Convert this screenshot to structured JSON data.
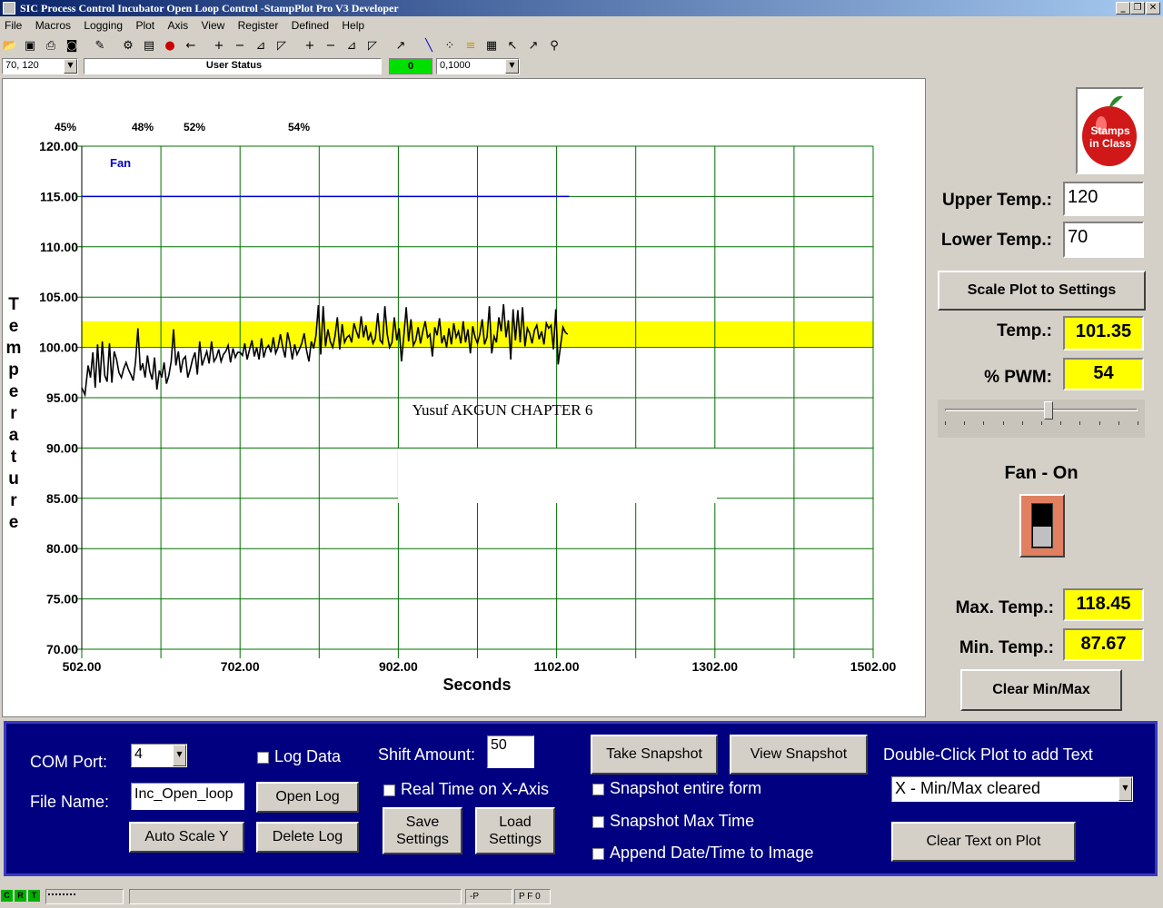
{
  "window": {
    "title": "SIC Process Control Incubator Open Loop Control -StampPlot Pro V3 Developer"
  },
  "menu": [
    "File",
    "Macros",
    "Logging",
    "Plot",
    "Axis",
    "View",
    "Register",
    "Defined",
    "Help"
  ],
  "statusrow": {
    "range_value": "70, 120",
    "user_status": "User Status",
    "counter": "0",
    "scale_value": "0,1000"
  },
  "plot": {
    "percent_labels": [
      "45%",
      "48%",
      "52%",
      "54%"
    ],
    "fan_label": "Fan",
    "annotation": "Yusuf AKGUN CHAPTER 6",
    "ylabel_letters": [
      "T",
      "e",
      "m",
      "p",
      "e",
      "r",
      "a",
      "t",
      "u",
      "r",
      "e"
    ],
    "colors": {
      "grid": "#007000",
      "trace": "#000000",
      "fan_line": "#0000cc",
      "band": "#ffff00"
    }
  },
  "chart_data": {
    "type": "line",
    "xlabel": "Seconds",
    "ylabel": "Temperature",
    "xlim": [
      502,
      1502
    ],
    "ylim": [
      70,
      120
    ],
    "x_ticks": [
      "502.00",
      "702.00",
      "902.00",
      "1102.00",
      "1302.00",
      "1502.00"
    ],
    "y_ticks": [
      "120.00",
      "115.00",
      "110.00",
      "105.00",
      "100.00",
      "95.00",
      "90.00",
      "85.00",
      "80.00",
      "75.00",
      "70.00"
    ],
    "band": {
      "y_from": 100.0,
      "y_to": 102.6
    },
    "fan_line": {
      "y": 115,
      "x_from": 502,
      "x_to": 1118
    },
    "series": [
      {
        "x": [
          502,
          506,
          510,
          513,
          516,
          519,
          522,
          525,
          528,
          531,
          534,
          537,
          540,
          543,
          546,
          549,
          552,
          555,
          558,
          561,
          564,
          567,
          570,
          573,
          576,
          579,
          582,
          585,
          588,
          591,
          594,
          597,
          600,
          603,
          606,
          609,
          612,
          615,
          618,
          621,
          624,
          627,
          630,
          633,
          636,
          639,
          642,
          645,
          648,
          651,
          654,
          657,
          660,
          663,
          666,
          669,
          672,
          675,
          678,
          681,
          684,
          687,
          690,
          693,
          696,
          699,
          702,
          705,
          708,
          711,
          714,
          717,
          720,
          723,
          726,
          729,
          732,
          735,
          738,
          741,
          744,
          747,
          750,
          753,
          756,
          759,
          762,
          765,
          768,
          771,
          774,
          777,
          780,
          783,
          786,
          789,
          792,
          795,
          798,
          801,
          804,
          807,
          810,
          813,
          816,
          819,
          822,
          825,
          828,
          831,
          834,
          837,
          840,
          843,
          846,
          849,
          852,
          855,
          858,
          861,
          864,
          867,
          870,
          873,
          876,
          879,
          882,
          885,
          888,
          891,
          894,
          897,
          900,
          903,
          906,
          909,
          912,
          915,
          918,
          921,
          924,
          927,
          930,
          933,
          936,
          939,
          942,
          945,
          948,
          951,
          954,
          957,
          960,
          963,
          966,
          969,
          972,
          975,
          978,
          981,
          984,
          987,
          990,
          993,
          996,
          999,
          1002,
          1005,
          1008,
          1011,
          1014,
          1017,
          1020,
          1023,
          1026,
          1029,
          1032,
          1035,
          1038,
          1041,
          1044,
          1047,
          1050,
          1053,
          1056,
          1059,
          1062,
          1065,
          1068,
          1071,
          1074,
          1077,
          1080,
          1083,
          1086,
          1089,
          1092,
          1095,
          1098,
          1101,
          1104,
          1107,
          1110,
          1113,
          1116
        ],
        "y": [
          96.0,
          95.3,
          98.2,
          97.0,
          99.5,
          96.0,
          100.3,
          96.5,
          100.6,
          97.2,
          96.6,
          100.4,
          96.5,
          99.6,
          98.8,
          97.5,
          97.0,
          97.9,
          98.5,
          97.8,
          97.3,
          96.7,
          98.6,
          101.9,
          97.7,
          98.4,
          97.0,
          99.2,
          97.6,
          96.8,
          99.0,
          95.8,
          97.7,
          97.0,
          98.5,
          96.4,
          97.2,
          98.6,
          101.8,
          98.2,
          99.6,
          97.5,
          98.8,
          99.1,
          97.0,
          97.8,
          98.8,
          99.5,
          97.3,
          100.6,
          98.2,
          98.9,
          99.6,
          98.4,
          100.6,
          98.6,
          99.0,
          99.8,
          98.6,
          99.3,
          99.6,
          100.2,
          98.5,
          99.9,
          99.0,
          99.5,
          99.5,
          99.2,
          100.4,
          98.8,
          99.8,
          100.7,
          99.1,
          100.0,
          98.8,
          100.9,
          99.0,
          99.9,
          100.2,
          99.5,
          101.0,
          99.4,
          100.0,
          101.3,
          100.0,
          99.0,
          101.5,
          100.4,
          98.8,
          100.3,
          99.3,
          99.8,
          100.4,
          101.4,
          99.7,
          98.6,
          100.6,
          99.9,
          101.2,
          104.2,
          99.3,
          104.1,
          100.1,
          101.8,
          100.6,
          100.0,
          101.1,
          103.0,
          99.8,
          102.3,
          100.5,
          101.0,
          101.2,
          100.5,
          102.4,
          101.6,
          100.9,
          103.1,
          101.0,
          102.2,
          100.7,
          101.4,
          100.4,
          100.9,
          103.4,
          100.7,
          100.4,
          104.1,
          101.3,
          100.0,
          100.5,
          103.0,
          100.7,
          101.9,
          98.6,
          101.2,
          104.0,
          100.6,
          102.8,
          100.2,
          100.7,
          102.0,
          100.4,
          101.6,
          102.6,
          101.0,
          101.3,
          99.1,
          102.0,
          101.2,
          102.9,
          100.4,
          101.2,
          100.0,
          101.9,
          100.3,
          102.4,
          101.0,
          101.6,
          100.4,
          102.6,
          100.5,
          101.8,
          99.4,
          102.1,
          101.0,
          100.4,
          101.3,
          102.8,
          100.3,
          101.0,
          104.1,
          99.4,
          101.1,
          100.5,
          103.0,
          101.6,
          104.3,
          101.0,
          102.7,
          98.8,
          103.8,
          100.7,
          103.7,
          100.5,
          104.0,
          100.1,
          101.9,
          101.4,
          100.4,
          101.7,
          102.2,
          100.8,
          101.6,
          100.3,
          102.4,
          101.9,
          102.2,
          99.8,
          103.8,
          98.3,
          100.2,
          102.0,
          101.5,
          101.3
        ]
      }
    ]
  },
  "right_panel": {
    "upper_label": "Upper Temp.:",
    "upper_value": "120",
    "lower_label": "Lower Temp.:",
    "lower_value": "70",
    "scale_button": "Scale Plot to Settings",
    "temp_label": "Temp.:",
    "temp_value": "101.35",
    "pwm_label": "% PWM:",
    "pwm_value": "54",
    "pwm_slider_fraction": 0.54,
    "fan_status": "Fan - On",
    "max_label": "Max. Temp.:",
    "max_value": "118.45",
    "min_label": "Min. Temp.:",
    "min_value": "87.67",
    "clear_button": "Clear Min/Max"
  },
  "bottom_panel": {
    "com_label": "COM Port:",
    "com_value": "4",
    "log_data_label": "Log Data",
    "shift_label": "Shift Amount:",
    "shift_value": "50",
    "take_snapshot": "Take Snapshot",
    "view_snapshot": "View Snapshot",
    "double_click_hint": "Double-Click Plot to add Text",
    "file_label": "File Name:",
    "file_value": "Inc_Open_loop",
    "open_log": "Open Log",
    "real_time_label": "Real Time on X-Axis",
    "snapshot_form_label": "Snapshot entire form",
    "text_select_value": "X - Min/Max cleared",
    "auto_scale": "Auto Scale Y",
    "delete_log": "Delete Log",
    "save_settings_1": "Save",
    "save_settings_2": "Settings",
    "load_settings_1": "Load",
    "load_settings_2": "Settings",
    "snapshot_max_label": "Snapshot Max Time",
    "append_date_label": "Append Date/Time to Image",
    "clear_text": "Clear Text on Plot"
  },
  "statusbar": {
    "indicators": [
      "C",
      "R",
      "T"
    ],
    "cell_p": "-P",
    "cell_pf": "P F 0"
  },
  "icons": {
    "logo_text_1": "Stamps",
    "logo_text_2": "in Class"
  }
}
